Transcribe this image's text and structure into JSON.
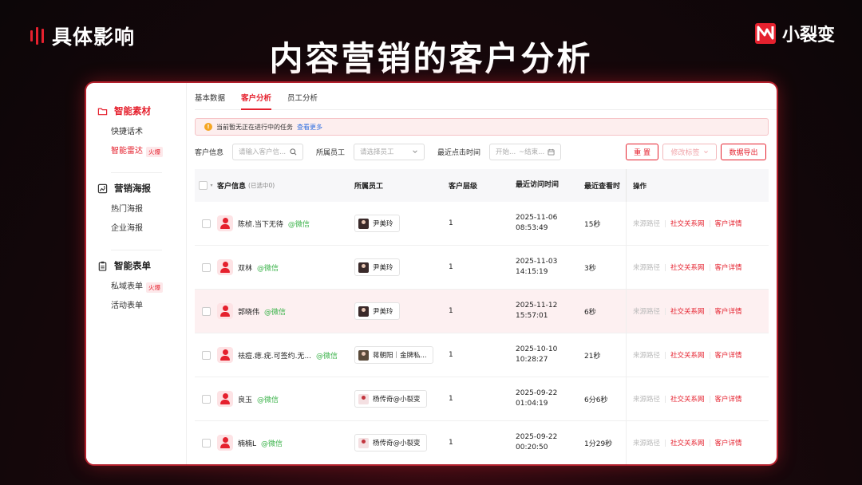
{
  "header": {
    "left_brand": "具体影响",
    "right_brand": "小裂变",
    "title": "内容营销的客户分析"
  },
  "sidebar": {
    "groups": [
      {
        "label": "智能素材",
        "icon": "folder-icon",
        "active": true,
        "items": [
          {
            "label": "快捷话术"
          },
          {
            "label": "智能雷达",
            "badge": "火爆",
            "active": true
          }
        ]
      },
      {
        "label": "营销海报",
        "icon": "image-icon",
        "items": [
          {
            "label": "热门海报"
          },
          {
            "label": "企业海报"
          }
        ]
      },
      {
        "label": "智能表单",
        "icon": "clipboard-icon",
        "items": [
          {
            "label": "私域表单",
            "badge": "火爆"
          },
          {
            "label": "活动表单"
          }
        ]
      }
    ]
  },
  "tabs": [
    {
      "label": "基本数据"
    },
    {
      "label": "客户分析",
      "active": true
    },
    {
      "label": "员工分析"
    }
  ],
  "notice": {
    "text": "当前暂无正在进行中的任务",
    "link": "查看更多"
  },
  "filters": {
    "customer_label": "客户信息",
    "customer_placeholder": "请输入客户信...",
    "employee_label": "所属员工",
    "employee_placeholder": "请选择员工",
    "time_label": "最近点击时间",
    "start_placeholder": "开始...",
    "end_placeholder": "~结束...",
    "reset": "重 置",
    "edit_tags": "修改标签",
    "export": "数据导出"
  },
  "table": {
    "columns": {
      "customer": "客户信息",
      "selected": "(已选中0)",
      "employee": "所属员工",
      "level": "客户层级",
      "last_visit": "最近访问时间",
      "last_view": "最近查看时",
      "ops": "操作"
    },
    "ops": {
      "source": "来源路径",
      "social": "社交关系网",
      "detail": "客户详情"
    },
    "rows": [
      {
        "name": "陈桢.当下无待",
        "channel": "@微信",
        "employee": "尹美玲",
        "level": "1",
        "date": "2025-11-06",
        "time": "08:53:49",
        "view": "15秒"
      },
      {
        "name": "双林",
        "channel": "@微信",
        "employee": "尹美玲",
        "level": "1",
        "date": "2025-11-03",
        "time": "14:15:19",
        "view": "3秒"
      },
      {
        "name": "郭晓伟",
        "channel": "@微信",
        "employee": "尹美玲",
        "level": "1",
        "date": "2025-11-12",
        "time": "15:57:01",
        "view": "6秒"
      },
      {
        "name": "祛痘.痣.疣.可签约.无...",
        "channel": "@微信",
        "employee": "蒋朝阳｜金牌私...",
        "level": "1",
        "date": "2025-10-10",
        "time": "10:28:27",
        "view": "21秒"
      },
      {
        "name": "良玉",
        "channel": "@微信",
        "employee": "杨传奇@小裂变",
        "level": "1",
        "date": "2025-09-22",
        "time": "01:04:19",
        "view": "6分6秒"
      },
      {
        "name": "楠楠L",
        "channel": "@微信",
        "employee": "杨传奇@小裂变",
        "level": "1",
        "date": "2025-09-22",
        "time": "00:20:50",
        "view": "1分29秒"
      }
    ]
  },
  "colors": {
    "accent": "#e5212e",
    "wechat": "#3bb34a",
    "link": "#2f6fe0"
  }
}
